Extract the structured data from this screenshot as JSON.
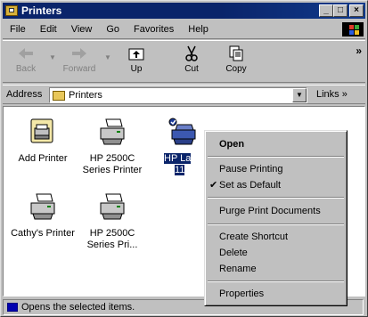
{
  "window": {
    "title": "Printers"
  },
  "menu": [
    "File",
    "Edit",
    "View",
    "Go",
    "Favorites",
    "Help"
  ],
  "toolbar": {
    "back": "Back",
    "forward": "Forward",
    "up": "Up",
    "cut": "Cut",
    "copy": "Copy",
    "more": "»"
  },
  "address": {
    "label": "Address",
    "value": "Printers",
    "links": "Links »"
  },
  "items": [
    {
      "label_1": "Add Printer",
      "label_2": "",
      "icon": "add-printer-icon"
    },
    {
      "label_1": "HP 2500C",
      "label_2": "Series Printer",
      "icon": "printer-icon"
    },
    {
      "label_1": "HP La",
      "label_2": "11",
      "icon": "network-printer-icon"
    },
    {
      "label_1": "Cathy's Printer",
      "label_2": "",
      "icon": "printer-icon"
    },
    {
      "label_1": "HP 2500C",
      "label_2": "Series Pri...",
      "icon": "printer-icon"
    }
  ],
  "context_menu": {
    "open": "Open",
    "pause": "Pause Printing",
    "default": "Set as Default",
    "default_check": "✔",
    "purge": "Purge Print Documents",
    "shortcut": "Create Shortcut",
    "delete": "Delete",
    "rename": "Rename",
    "properties": "Properties"
  },
  "status": {
    "text": "Opens the selected items."
  }
}
